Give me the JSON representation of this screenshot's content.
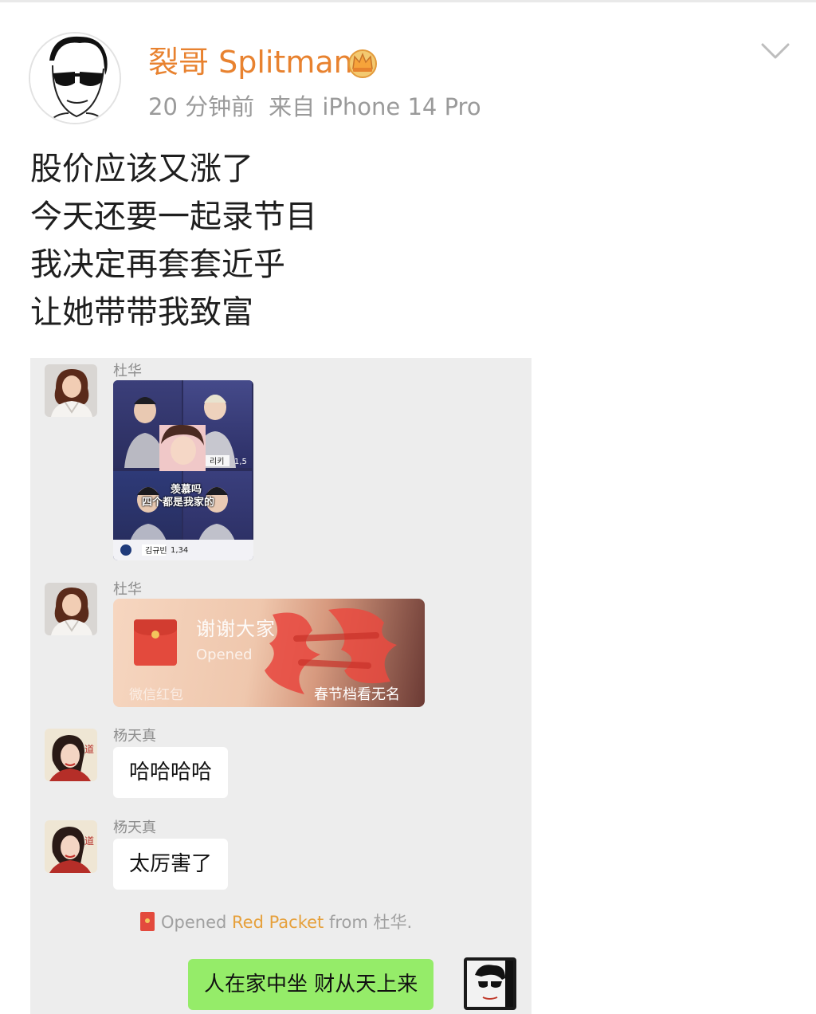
{
  "post": {
    "username": "裂哥 Splitman",
    "time": "20 分钟前",
    "source": "来自 iPhone 14 Pro",
    "lines": [
      "股价应该又涨了",
      "今天还要一起录节目",
      "我决定再套套近乎",
      "让她带带我致富"
    ]
  },
  "chat": {
    "messages": [
      {
        "sender": "杜华",
        "type": "image",
        "caption_line1": "羡慕吗",
        "caption_line2": "四个都是我家的",
        "score1": "1,5",
        "score2": "1,34"
      },
      {
        "sender": "杜华",
        "type": "red-packet",
        "title": "谢谢大家",
        "status": "Opened",
        "app_label": "微信红包",
        "promo": "春节档看无名"
      },
      {
        "sender": "杨天真",
        "type": "text",
        "text": "哈哈哈哈"
      },
      {
        "sender": "杨天真",
        "type": "text",
        "text": "太厉害了"
      }
    ],
    "system": {
      "prefix": "Opened ",
      "highlight": "Red Packet",
      "suffix": " from 杜华."
    },
    "self_message": "人在家中坐 财从天上来"
  },
  "colors": {
    "username": "#e8822f",
    "meta": "#9a9a9a",
    "chat_bg": "#ededed",
    "self_bubble": "#95ec69",
    "packet_red": "#e34a3d",
    "packet_link": "#e6a03b"
  },
  "icons": {
    "avatar": "avatar-icon",
    "crown": "crown-icon",
    "menu": "chevron-down-icon"
  }
}
